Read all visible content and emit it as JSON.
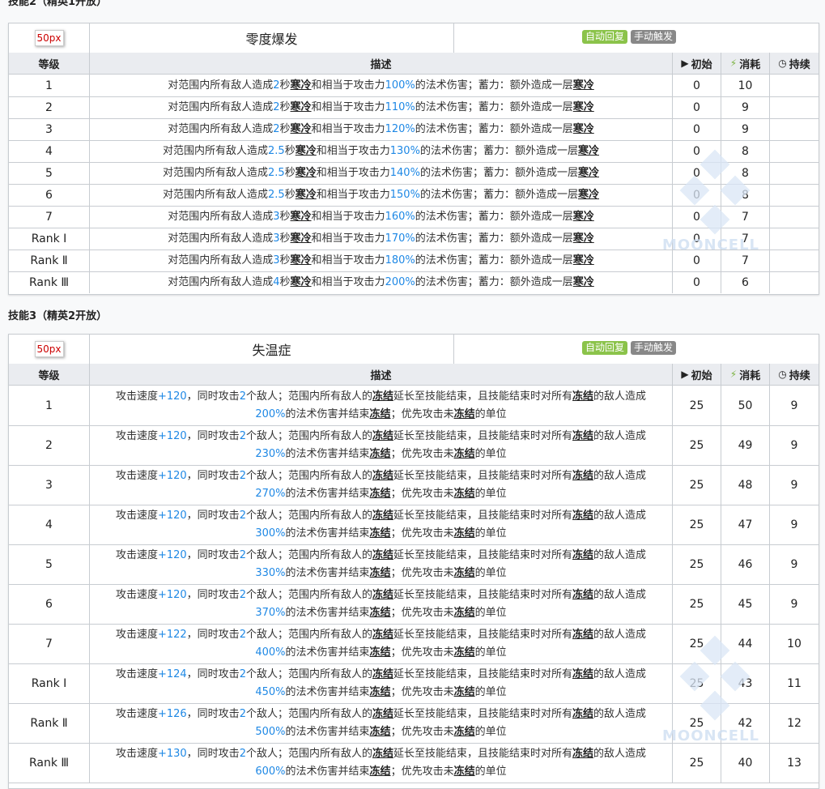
{
  "skill2": {
    "section_title": "技能2（精英1开放）",
    "icon_label": "50px",
    "name": "零度爆发",
    "tag_auto": "自动回复",
    "tag_manual": "手动触发",
    "headers": {
      "level": "等级",
      "desc": "描述",
      "init": "初始",
      "cost": "消耗",
      "dur": "持续"
    },
    "rows": [
      {
        "level": "1",
        "t": "2",
        "p": "100%",
        "init": "0",
        "cost": "10",
        "dur": ""
      },
      {
        "level": "2",
        "t": "2",
        "p": "110%",
        "init": "0",
        "cost": "9",
        "dur": ""
      },
      {
        "level": "3",
        "t": "2",
        "p": "120%",
        "init": "0",
        "cost": "9",
        "dur": ""
      },
      {
        "level": "4",
        "t": "2.5",
        "p": "130%",
        "init": "0",
        "cost": "8",
        "dur": ""
      },
      {
        "level": "5",
        "t": "2.5",
        "p": "140%",
        "init": "0",
        "cost": "8",
        "dur": ""
      },
      {
        "level": "6",
        "t": "2.5",
        "p": "150%",
        "init": "0",
        "cost": "8",
        "dur": ""
      },
      {
        "level": "7",
        "t": "3",
        "p": "160%",
        "init": "0",
        "cost": "7",
        "dur": ""
      },
      {
        "level": "Rank Ⅰ",
        "t": "3",
        "p": "170%",
        "init": "0",
        "cost": "7",
        "dur": ""
      },
      {
        "level": "Rank Ⅱ",
        "t": "3",
        "p": "180%",
        "init": "0",
        "cost": "7",
        "dur": ""
      },
      {
        "level": "Rank Ⅲ",
        "t": "4",
        "p": "200%",
        "init": "0",
        "cost": "6",
        "dur": ""
      }
    ],
    "desc_parts": {
      "a": "对范围内所有敌人造成",
      "b": "秒",
      "kw1": "寒冷",
      "c": "和相当于攻击力",
      "d": "的法术伤害；蓄力：额外造成一层",
      "kw2": "寒冷"
    }
  },
  "skill3": {
    "section_title": "技能3（精英2开放）",
    "icon_label": "50px",
    "name": "失温症",
    "tag_auto": "自动回复",
    "tag_manual": "手动触发",
    "headers": {
      "level": "等级",
      "desc": "描述",
      "init": "初始",
      "cost": "消耗",
      "dur": "持续"
    },
    "rows": [
      {
        "level": "1",
        "spd": "+120",
        "p": "200%",
        "init": "25",
        "cost": "50",
        "dur": "9"
      },
      {
        "level": "2",
        "spd": "+120",
        "p": "230%",
        "init": "25",
        "cost": "49",
        "dur": "9"
      },
      {
        "level": "3",
        "spd": "+120",
        "p": "270%",
        "init": "25",
        "cost": "48",
        "dur": "9"
      },
      {
        "level": "4",
        "spd": "+120",
        "p": "300%",
        "init": "25",
        "cost": "47",
        "dur": "9"
      },
      {
        "level": "5",
        "spd": "+120",
        "p": "330%",
        "init": "25",
        "cost": "46",
        "dur": "9"
      },
      {
        "level": "6",
        "spd": "+120",
        "p": "370%",
        "init": "25",
        "cost": "45",
        "dur": "9"
      },
      {
        "level": "7",
        "spd": "+122",
        "p": "400%",
        "init": "25",
        "cost": "44",
        "dur": "10"
      },
      {
        "level": "Rank Ⅰ",
        "spd": "+124",
        "p": "450%",
        "init": "25",
        "cost": "43",
        "dur": "11"
      },
      {
        "level": "Rank Ⅱ",
        "spd": "+126",
        "p": "500%",
        "init": "25",
        "cost": "42",
        "dur": "12"
      },
      {
        "level": "Rank Ⅲ",
        "spd": "+130",
        "p": "600%",
        "init": "25",
        "cost": "40",
        "dur": "13"
      }
    ],
    "desc_parts": {
      "a": "攻击速度",
      "b": "，同时攻击",
      "n": "2",
      "c": "个敌人；范围内所有敌人的",
      "kw1": "冻结",
      "d": "延长至技能结束，且技能结束时对所有",
      "kw2": "冻结",
      "e": "的敌人造成",
      "f": "的法术伤害并结束",
      "kw3": "冻结",
      "g": "；优先攻击未",
      "kw4": "冻结",
      "h": "的单位"
    }
  },
  "watermark": "MOONCELL"
}
